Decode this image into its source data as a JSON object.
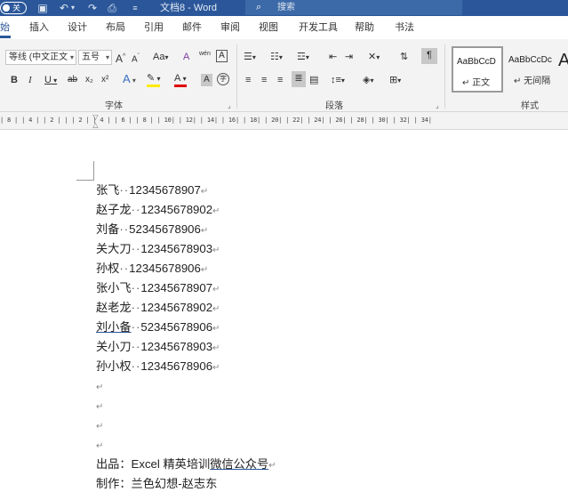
{
  "titlebar": {
    "toggle_label": "关",
    "doc_title": "文档8 - Word",
    "search_placeholder": "搜索"
  },
  "tabs": [
    "始",
    "插入",
    "设计",
    "布局",
    "引用",
    "邮件",
    "审阅",
    "视图",
    "开发工具",
    "帮助",
    "书法"
  ],
  "ribbon": {
    "font_name": "等线 (中文正文",
    "font_size": "五号",
    "grow_font": "A",
    "shrink_font": "A",
    "change_case": "Aa",
    "clear_format": "A",
    "phonetic": "wén",
    "char_border": "A",
    "bold": "B",
    "italic": "I",
    "underline": "U",
    "strike": "ab",
    "subscript": "x₂",
    "superscript": "x²",
    "text_effect": "A",
    "highlight": "✎",
    "font_color": "A",
    "char_shading": "A",
    "enclose": "字",
    "group_font": "字体",
    "group_paragraph": "段落",
    "group_styles": "样式",
    "style_normal_sample": "AaBbCcD",
    "style_normal_name": "↵ 正文",
    "style_nospace_sample": "AaBbCcDc",
    "style_nospace_name": "↵ 无间隔",
    "style_heading_sample": "A"
  },
  "ruler_text": "| 8 |  | 4 |  | 2 |  |    | 2 |  | 4 |  | 6 |  | 8 |  | 10|  | 12|  | 14|  | 16|  | 18|  | 20|  | 22|  | 24|  | 26|  | 28|  | 30|  | 32|  | 34|",
  "document": {
    "lines": [
      {
        "name": "张飞",
        "sep": "··",
        "phone": "12345678907"
      },
      {
        "name": "赵子龙",
        "sep": "··",
        "phone": "12345678902"
      },
      {
        "name": "刘备",
        "sep": "··",
        "phone": "52345678906"
      },
      {
        "name": "关大刀",
        "sep": "··",
        "phone": "12345678903"
      },
      {
        "name": "孙权",
        "sep": "··",
        "phone": "12345678906"
      },
      {
        "name": "张小飞",
        "sep": "··",
        "phone": "12345678907"
      },
      {
        "name": "赵老龙",
        "sep": "··",
        "phone": "12345678902"
      },
      {
        "name": "刘小备",
        "sep": "··",
        "phone": "52345678906"
      },
      {
        "name": "关小刀",
        "sep": "··",
        "phone": "12345678903"
      },
      {
        "name": "孙小权",
        "sep": "··",
        "phone": "12345678906"
      }
    ],
    "para_mark": "↵",
    "footer_label": "出品：Excel 精英培训",
    "footer_link": "微信公众号",
    "footer2": "制作：兰色幻想-赵志东"
  },
  "colors": {
    "accent": "#2b579a"
  }
}
